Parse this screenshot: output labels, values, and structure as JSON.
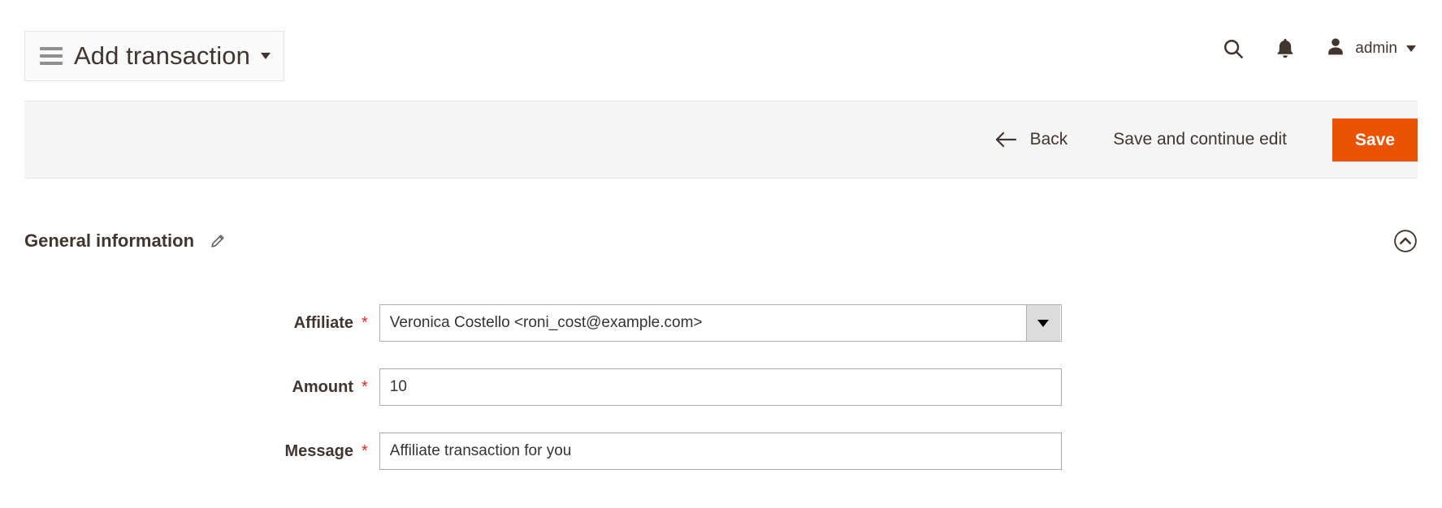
{
  "header": {
    "title": "Add transaction",
    "menu_icon": "hamburger-icon",
    "title_caret_icon": "caret-down-icon",
    "search_icon": "search-icon",
    "notifications_icon": "bell-icon",
    "user_icon": "user-avatar-icon",
    "user_name": "admin",
    "user_caret_icon": "caret-down-icon"
  },
  "actions": {
    "back_label": "Back",
    "back_icon": "arrow-left-icon",
    "save_continue_label": "Save and continue edit",
    "save_label": "Save",
    "primary_color": "#eb5202"
  },
  "section": {
    "title": "General information",
    "edit_icon": "pencil-icon",
    "collapse_icon": "chevron-up-circle-icon"
  },
  "form": {
    "required_marker": "*",
    "fields": [
      {
        "label": "Affiliate",
        "type": "select",
        "value": "Veronica Costello <roni_cost@example.com>",
        "required": true
      },
      {
        "label": "Amount",
        "type": "text",
        "value": "10",
        "placeholder": "",
        "required": true
      },
      {
        "label": "Message",
        "type": "text",
        "value": "Affiliate transaction for you",
        "placeholder": "",
        "required": true
      }
    ]
  },
  "colors": {
    "text": "#41362f",
    "required_star": "#e02b27",
    "action_bar_bg": "#f5f5f5",
    "input_border": "#adadad"
  }
}
